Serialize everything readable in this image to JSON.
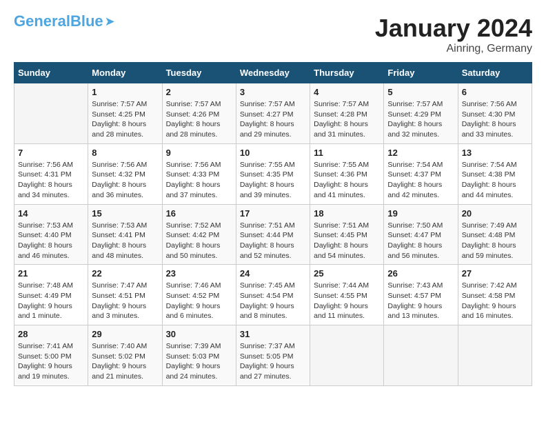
{
  "logo": {
    "general": "General",
    "blue": "Blue"
  },
  "title": "January 2024",
  "subtitle": "Ainring, Germany",
  "days_header": [
    "Sunday",
    "Monday",
    "Tuesday",
    "Wednesday",
    "Thursday",
    "Friday",
    "Saturday"
  ],
  "weeks": [
    [
      {
        "num": "",
        "sunrise": "",
        "sunset": "",
        "daylight": ""
      },
      {
        "num": "1",
        "sunrise": "Sunrise: 7:57 AM",
        "sunset": "Sunset: 4:25 PM",
        "daylight": "Daylight: 8 hours and 28 minutes."
      },
      {
        "num": "2",
        "sunrise": "Sunrise: 7:57 AM",
        "sunset": "Sunset: 4:26 PM",
        "daylight": "Daylight: 8 hours and 28 minutes."
      },
      {
        "num": "3",
        "sunrise": "Sunrise: 7:57 AM",
        "sunset": "Sunset: 4:27 PM",
        "daylight": "Daylight: 8 hours and 29 minutes."
      },
      {
        "num": "4",
        "sunrise": "Sunrise: 7:57 AM",
        "sunset": "Sunset: 4:28 PM",
        "daylight": "Daylight: 8 hours and 31 minutes."
      },
      {
        "num": "5",
        "sunrise": "Sunrise: 7:57 AM",
        "sunset": "Sunset: 4:29 PM",
        "daylight": "Daylight: 8 hours and 32 minutes."
      },
      {
        "num": "6",
        "sunrise": "Sunrise: 7:56 AM",
        "sunset": "Sunset: 4:30 PM",
        "daylight": "Daylight: 8 hours and 33 minutes."
      }
    ],
    [
      {
        "num": "7",
        "sunrise": "Sunrise: 7:56 AM",
        "sunset": "Sunset: 4:31 PM",
        "daylight": "Daylight: 8 hours and 34 minutes."
      },
      {
        "num": "8",
        "sunrise": "Sunrise: 7:56 AM",
        "sunset": "Sunset: 4:32 PM",
        "daylight": "Daylight: 8 hours and 36 minutes."
      },
      {
        "num": "9",
        "sunrise": "Sunrise: 7:56 AM",
        "sunset": "Sunset: 4:33 PM",
        "daylight": "Daylight: 8 hours and 37 minutes."
      },
      {
        "num": "10",
        "sunrise": "Sunrise: 7:55 AM",
        "sunset": "Sunset: 4:35 PM",
        "daylight": "Daylight: 8 hours and 39 minutes."
      },
      {
        "num": "11",
        "sunrise": "Sunrise: 7:55 AM",
        "sunset": "Sunset: 4:36 PM",
        "daylight": "Daylight: 8 hours and 41 minutes."
      },
      {
        "num": "12",
        "sunrise": "Sunrise: 7:54 AM",
        "sunset": "Sunset: 4:37 PM",
        "daylight": "Daylight: 8 hours and 42 minutes."
      },
      {
        "num": "13",
        "sunrise": "Sunrise: 7:54 AM",
        "sunset": "Sunset: 4:38 PM",
        "daylight": "Daylight: 8 hours and 44 minutes."
      }
    ],
    [
      {
        "num": "14",
        "sunrise": "Sunrise: 7:53 AM",
        "sunset": "Sunset: 4:40 PM",
        "daylight": "Daylight: 8 hours and 46 minutes."
      },
      {
        "num": "15",
        "sunrise": "Sunrise: 7:53 AM",
        "sunset": "Sunset: 4:41 PM",
        "daylight": "Daylight: 8 hours and 48 minutes."
      },
      {
        "num": "16",
        "sunrise": "Sunrise: 7:52 AM",
        "sunset": "Sunset: 4:42 PM",
        "daylight": "Daylight: 8 hours and 50 minutes."
      },
      {
        "num": "17",
        "sunrise": "Sunrise: 7:51 AM",
        "sunset": "Sunset: 4:44 PM",
        "daylight": "Daylight: 8 hours and 52 minutes."
      },
      {
        "num": "18",
        "sunrise": "Sunrise: 7:51 AM",
        "sunset": "Sunset: 4:45 PM",
        "daylight": "Daylight: 8 hours and 54 minutes."
      },
      {
        "num": "19",
        "sunrise": "Sunrise: 7:50 AM",
        "sunset": "Sunset: 4:47 PM",
        "daylight": "Daylight: 8 hours and 56 minutes."
      },
      {
        "num": "20",
        "sunrise": "Sunrise: 7:49 AM",
        "sunset": "Sunset: 4:48 PM",
        "daylight": "Daylight: 8 hours and 59 minutes."
      }
    ],
    [
      {
        "num": "21",
        "sunrise": "Sunrise: 7:48 AM",
        "sunset": "Sunset: 4:49 PM",
        "daylight": "Daylight: 9 hours and 1 minute."
      },
      {
        "num": "22",
        "sunrise": "Sunrise: 7:47 AM",
        "sunset": "Sunset: 4:51 PM",
        "daylight": "Daylight: 9 hours and 3 minutes."
      },
      {
        "num": "23",
        "sunrise": "Sunrise: 7:46 AM",
        "sunset": "Sunset: 4:52 PM",
        "daylight": "Daylight: 9 hours and 6 minutes."
      },
      {
        "num": "24",
        "sunrise": "Sunrise: 7:45 AM",
        "sunset": "Sunset: 4:54 PM",
        "daylight": "Daylight: 9 hours and 8 minutes."
      },
      {
        "num": "25",
        "sunrise": "Sunrise: 7:44 AM",
        "sunset": "Sunset: 4:55 PM",
        "daylight": "Daylight: 9 hours and 11 minutes."
      },
      {
        "num": "26",
        "sunrise": "Sunrise: 7:43 AM",
        "sunset": "Sunset: 4:57 PM",
        "daylight": "Daylight: 9 hours and 13 minutes."
      },
      {
        "num": "27",
        "sunrise": "Sunrise: 7:42 AM",
        "sunset": "Sunset: 4:58 PM",
        "daylight": "Daylight: 9 hours and 16 minutes."
      }
    ],
    [
      {
        "num": "28",
        "sunrise": "Sunrise: 7:41 AM",
        "sunset": "Sunset: 5:00 PM",
        "daylight": "Daylight: 9 hours and 19 minutes."
      },
      {
        "num": "29",
        "sunrise": "Sunrise: 7:40 AM",
        "sunset": "Sunset: 5:02 PM",
        "daylight": "Daylight: 9 hours and 21 minutes."
      },
      {
        "num": "30",
        "sunrise": "Sunrise: 7:39 AM",
        "sunset": "Sunset: 5:03 PM",
        "daylight": "Daylight: 9 hours and 24 minutes."
      },
      {
        "num": "31",
        "sunrise": "Sunrise: 7:37 AM",
        "sunset": "Sunset: 5:05 PM",
        "daylight": "Daylight: 9 hours and 27 minutes."
      },
      {
        "num": "",
        "sunrise": "",
        "sunset": "",
        "daylight": ""
      },
      {
        "num": "",
        "sunrise": "",
        "sunset": "",
        "daylight": ""
      },
      {
        "num": "",
        "sunrise": "",
        "sunset": "",
        "daylight": ""
      }
    ]
  ]
}
